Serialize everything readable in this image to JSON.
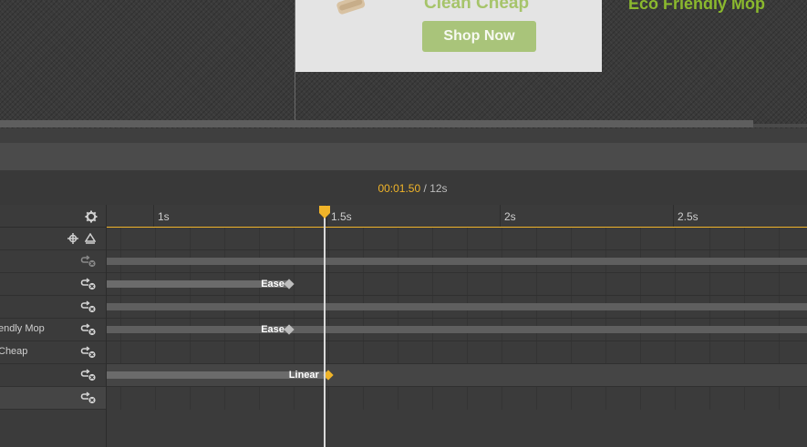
{
  "canvas": {
    "banner": {
      "title": "Clean Cheap",
      "button_label": "Shop Now"
    },
    "headline": "Eco Friendly Mop"
  },
  "timeline": {
    "current_time": "00:01.50",
    "separator": "/",
    "total_time": "12s",
    "playhead_seconds": 1.5,
    "ruler_ticks": [
      "1s",
      "1.5s",
      "2s",
      "2.5s"
    ],
    "header_icons": {
      "settings": "gear-icon",
      "add_key": "crosshair-icon",
      "layer": "triangle-icon"
    }
  },
  "layers": [
    {
      "name": "",
      "icon": "loop-delete-icon",
      "bar": "none"
    },
    {
      "name": "",
      "icon": "loop-delete-icon",
      "bar": "full"
    },
    {
      "name": "",
      "icon": "loop-delete-icon",
      "bar": "ease",
      "ease": "Ease"
    },
    {
      "name": "endly Mop",
      "icon": "loop-delete-icon",
      "bar": "full"
    },
    {
      "name": "Cheap",
      "icon": "loop-delete-icon",
      "bar": "ease-full",
      "ease": "Ease"
    },
    {
      "name": "",
      "icon": "loop-delete-icon",
      "bar": "none"
    },
    {
      "name": "",
      "icon": "loop-delete-icon",
      "bar": "linear",
      "ease": "Linear",
      "selected": true
    }
  ],
  "colors": {
    "accent": "#f0b429",
    "brand_green": "#8bb92e",
    "button_green": "#a9c47a"
  }
}
